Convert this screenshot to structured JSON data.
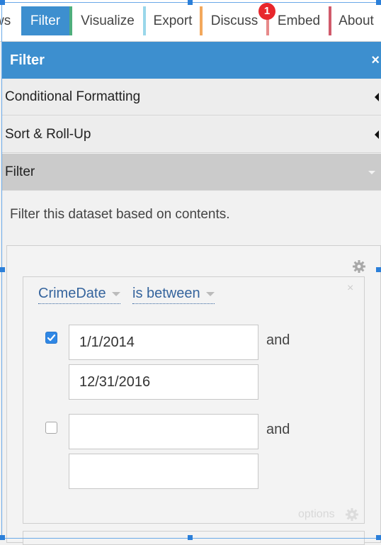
{
  "tabs": [
    {
      "label": "ws"
    },
    {
      "label": "Filter"
    },
    {
      "label": "Visualize"
    },
    {
      "label": "Export"
    },
    {
      "label": "Discuss"
    },
    {
      "label": "Embed"
    },
    {
      "label": "About"
    }
  ],
  "discuss_badge": "1",
  "panel": {
    "title": "Filter",
    "close_icon": "×"
  },
  "sections": {
    "conditional_formatting": "Conditional Formatting",
    "sort_rollup": "Sort & Roll-Up",
    "filter": "Filter"
  },
  "description": "Filter this dataset based on contents.",
  "condition": {
    "column": "CrimeDate",
    "operator": "is between",
    "and_label": "and",
    "rows": [
      {
        "checked": true,
        "from": "1/1/2014",
        "to": "12/31/2016"
      },
      {
        "checked": false,
        "from": "",
        "to": ""
      }
    ],
    "options_label": "options",
    "remove_icon": "×"
  },
  "colors": {
    "accent": "#3d8fcf",
    "link": "#35649d",
    "badge": "#e8272c"
  },
  "icons": {
    "gear": "gear-icon",
    "check": "check-icon",
    "close": "close-icon"
  }
}
